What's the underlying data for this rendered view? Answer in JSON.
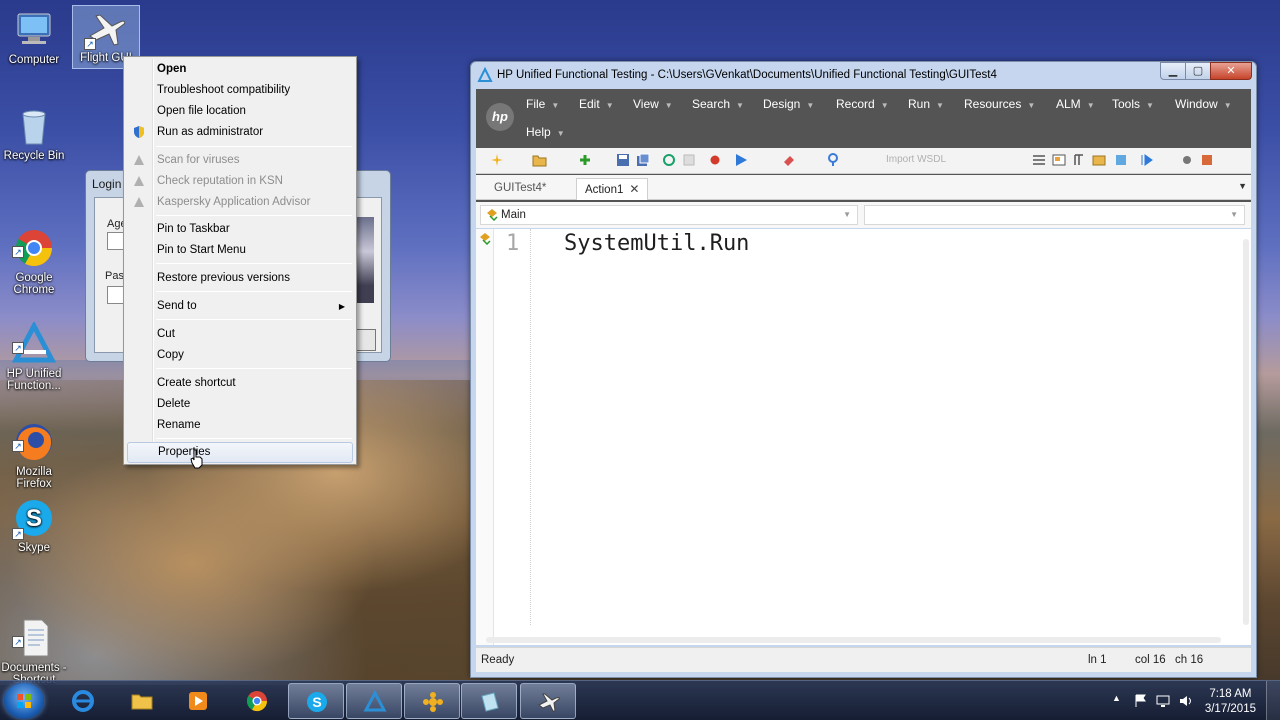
{
  "desktop": {
    "icons": [
      {
        "label": "Computer",
        "icon": "computer-icon"
      },
      {
        "label": "Flight GUI",
        "icon": "airplane-icon"
      },
      {
        "label": "Recycle Bin",
        "icon": "recycle-bin-icon"
      },
      {
        "label": "Google\nChrome",
        "icon": "chrome-icon"
      },
      {
        "label": "HP Unified\nFunction...",
        "icon": "uft-icon"
      },
      {
        "label": "Mozilla\nFirefox",
        "icon": "firefox-icon"
      },
      {
        "label": "Skype",
        "icon": "skype-icon"
      },
      {
        "label": "Documents -\nShortcut",
        "icon": "document-icon"
      }
    ]
  },
  "login_window": {
    "title": "Login",
    "agent_label": "Age",
    "password_label": "Pas"
  },
  "context_menu": {
    "items": [
      {
        "label": "Open",
        "style": "bold"
      },
      {
        "label": "Troubleshoot compatibility",
        "style": "normal"
      },
      {
        "label": "Open file location",
        "style": "normal"
      },
      {
        "label": "Run as administrator",
        "style": "normal",
        "icon": "shield-icon"
      },
      {
        "label": "Scan for viruses",
        "style": "disabled",
        "icon": "kaspersky-icon"
      },
      {
        "label": "Check reputation in KSN",
        "style": "disabled",
        "icon": "kaspersky-icon"
      },
      {
        "label": "Kaspersky Application Advisor",
        "style": "disabled",
        "icon": "kaspersky-icon"
      },
      {
        "label": "Pin to Taskbar",
        "style": "normal"
      },
      {
        "label": "Pin to Start Menu",
        "style": "normal"
      },
      {
        "label": "Restore previous versions",
        "style": "normal"
      },
      {
        "label": "Send to",
        "style": "submenu"
      },
      {
        "label": "Cut",
        "style": "normal"
      },
      {
        "label": "Copy",
        "style": "normal"
      },
      {
        "label": "Create shortcut",
        "style": "normal"
      },
      {
        "label": "Delete",
        "style": "normal"
      },
      {
        "label": "Rename",
        "style": "normal"
      },
      {
        "label": "Properties",
        "style": "hover"
      }
    ]
  },
  "uft": {
    "title": "HP Unified Functional Testing - C:\\Users\\GVenkat\\Documents\\Unified Functional Testing\\GUITest4",
    "logo": "hp",
    "menus": [
      "File",
      "Edit",
      "View",
      "Search",
      "Design",
      "Record",
      "Run",
      "Resources",
      "ALM",
      "Tools",
      "Window",
      "Help"
    ],
    "toolbar_disabled_text": "Import WSDL",
    "tabs": [
      {
        "label": "GUITest4*",
        "active": false
      },
      {
        "label": "Action1",
        "active": true
      }
    ],
    "combo_left": "Main",
    "combo_right": "",
    "editor": {
      "line_number": "1",
      "code": "SystemUtil.Run"
    },
    "status": {
      "text": "Ready",
      "line": "ln 1",
      "col": "col 16",
      "ch": "ch 16"
    }
  },
  "taskbar": {
    "pinned": [
      "internet-explorer-icon",
      "file-explorer-icon",
      "media-player-icon",
      "chrome-icon",
      "skype-icon",
      "uft-icon",
      "app-icon",
      "notes-icon",
      "airplane-icon"
    ],
    "clock_time": "7:18 AM",
    "clock_date": "3/17/2015"
  },
  "colors": {
    "uft_menubar": "#545454",
    "window_chrome": "#c5d6ee",
    "taskbar": "#1c2a4a"
  }
}
